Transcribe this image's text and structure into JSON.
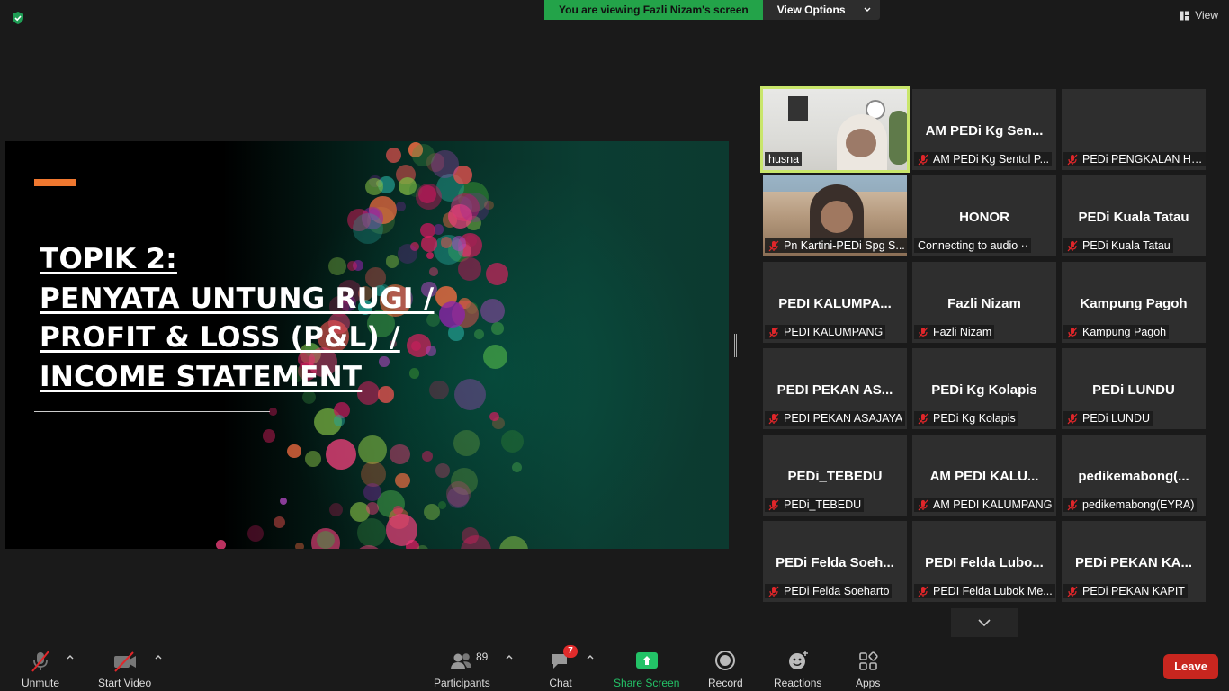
{
  "banner": {
    "message": "You are viewing Fazli Nizam's screen",
    "view_options": "View Options"
  },
  "top_right": {
    "view_label": "View"
  },
  "slide": {
    "title_lines": [
      "TOPIK 2:",
      "PENYATA UNTUNG RUGI /",
      "PROFIT & LOSS (P&L) /",
      "INCOME STATEMENT"
    ],
    "accent_color": "#f07830"
  },
  "participants_grid": [
    {
      "name": "",
      "label": "husna",
      "video": true,
      "active": true,
      "muted": false
    },
    {
      "name": "AM PEDi Kg Sen...",
      "label": "AM PEDi Kg Sentol P...",
      "muted": true
    },
    {
      "name": "",
      "label": "PEDi PENGKALAN HU...",
      "muted": true
    },
    {
      "name": "",
      "label": "Pn Kartini-PEDi Spg S...",
      "video": true,
      "muted": true
    },
    {
      "name": "HONOR",
      "label": "Connecting to audio ··",
      "muted": false
    },
    {
      "name": "PEDi Kuala Tatau",
      "label": "PEDi Kuala Tatau",
      "muted": true
    },
    {
      "name": "PEDI  KALUMPA...",
      "label": "PEDI KALUMPANG",
      "muted": true
    },
    {
      "name": "Fazli Nizam",
      "label": "Fazli Nizam",
      "muted": true
    },
    {
      "name": "Kampung Pagoh",
      "label": "Kampung Pagoh",
      "muted": true
    },
    {
      "name": "PEDI  PEKAN AS...",
      "label": "PEDI PEKAN ASAJAYA",
      "muted": true
    },
    {
      "name": "PEDi Kg Kolapis",
      "label": "PEDi Kg Kolapis",
      "muted": true
    },
    {
      "name": "PEDi LUNDU",
      "label": "PEDi LUNDU",
      "muted": true
    },
    {
      "name": "PEDi_TEBEDU",
      "label": "PEDi_TEBEDU",
      "muted": true
    },
    {
      "name": "AM PEDI KALU...",
      "label": "AM PEDI KALUMPANG",
      "muted": true
    },
    {
      "name": "pedikemabong(...",
      "label": "pedikemabong(EYRA)",
      "muted": true
    },
    {
      "name": "PEDi  Felda Soeh...",
      "label": "PEDi Felda Soeharto",
      "muted": true
    },
    {
      "name": "PEDI  Felda Lubo...",
      "label": "PEDI Felda Lubok Me...",
      "muted": true
    },
    {
      "name": "PEDi PEKAN KA...",
      "label": "PEDi PEKAN KAPIT",
      "muted": true
    }
  ],
  "toolbar": {
    "unmute": "Unmute",
    "start_video": "Start Video",
    "participants": "Participants",
    "participants_count": "89",
    "chat": "Chat",
    "chat_badge": "7",
    "share_screen": "Share Screen",
    "record": "Record",
    "reactions": "Reactions",
    "apps": "Apps",
    "leave": "Leave"
  },
  "colors": {
    "share_green": "#23c267",
    "leave_red": "#c8261f",
    "banner_green": "#23a349",
    "active_speaker": "#c9e66b"
  }
}
